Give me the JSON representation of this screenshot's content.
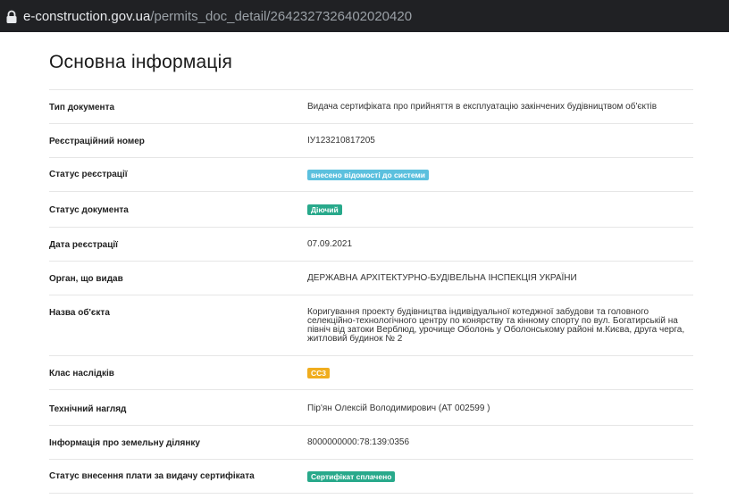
{
  "browser": {
    "url_host": "e-construction.gov.ua",
    "url_path": "/permits_doc_detail/2642327326402020420"
  },
  "page": {
    "title": "Основна інформація"
  },
  "rows": [
    {
      "label": "Тип документа",
      "value": "Видача сертифіката про прийняття в експлуатацію закінчених будівництвом об'єктів",
      "kind": "text"
    },
    {
      "label": "Реєстраційний номер",
      "value": "ІУ123210817205",
      "kind": "text"
    },
    {
      "label": "Статус реєстрації",
      "value": "внесено відомості до системи",
      "kind": "badge",
      "color": "#5bc0de"
    },
    {
      "label": "Статус документа",
      "value": "Діючий",
      "kind": "badge",
      "color": "#28a98b"
    },
    {
      "label": "Дата реєстрації",
      "value": "07.09.2021",
      "kind": "text"
    },
    {
      "label": "Орган, що видав",
      "value": "ДЕРЖАВНА АРХІТЕКТУРНО-БУДІВЕЛЬНА ІНСПЕКЦІЯ УКРАЇНИ",
      "kind": "text"
    },
    {
      "label": "Назва об'єкта",
      "value": "Коригування проекту будівництва індивідуальної котеджної забудови та головного селекційно-технологічного центру по конярству та кінному спорту по вул. Богатирській на північ від затоки Верблюд, урочище Оболонь у Оболонському районі м.Києва, друга черга, житловий будинок № 2",
      "kind": "text"
    },
    {
      "label": "Клас наслідків",
      "value": "СС3",
      "kind": "badge",
      "color": "#f0ad1e"
    },
    {
      "label": "Технічний нагляд",
      "value": "Пір'ян Олексій Володимирович (АТ 002599 )",
      "kind": "text"
    },
    {
      "label": "Інформація про земельну ділянку",
      "value": "8000000000:78:139:0356",
      "kind": "text"
    },
    {
      "label": "Статус внесення плати за видачу сертифіката",
      "value": "Сертифікат сплачено",
      "kind": "badge",
      "color": "#28a98b"
    }
  ]
}
